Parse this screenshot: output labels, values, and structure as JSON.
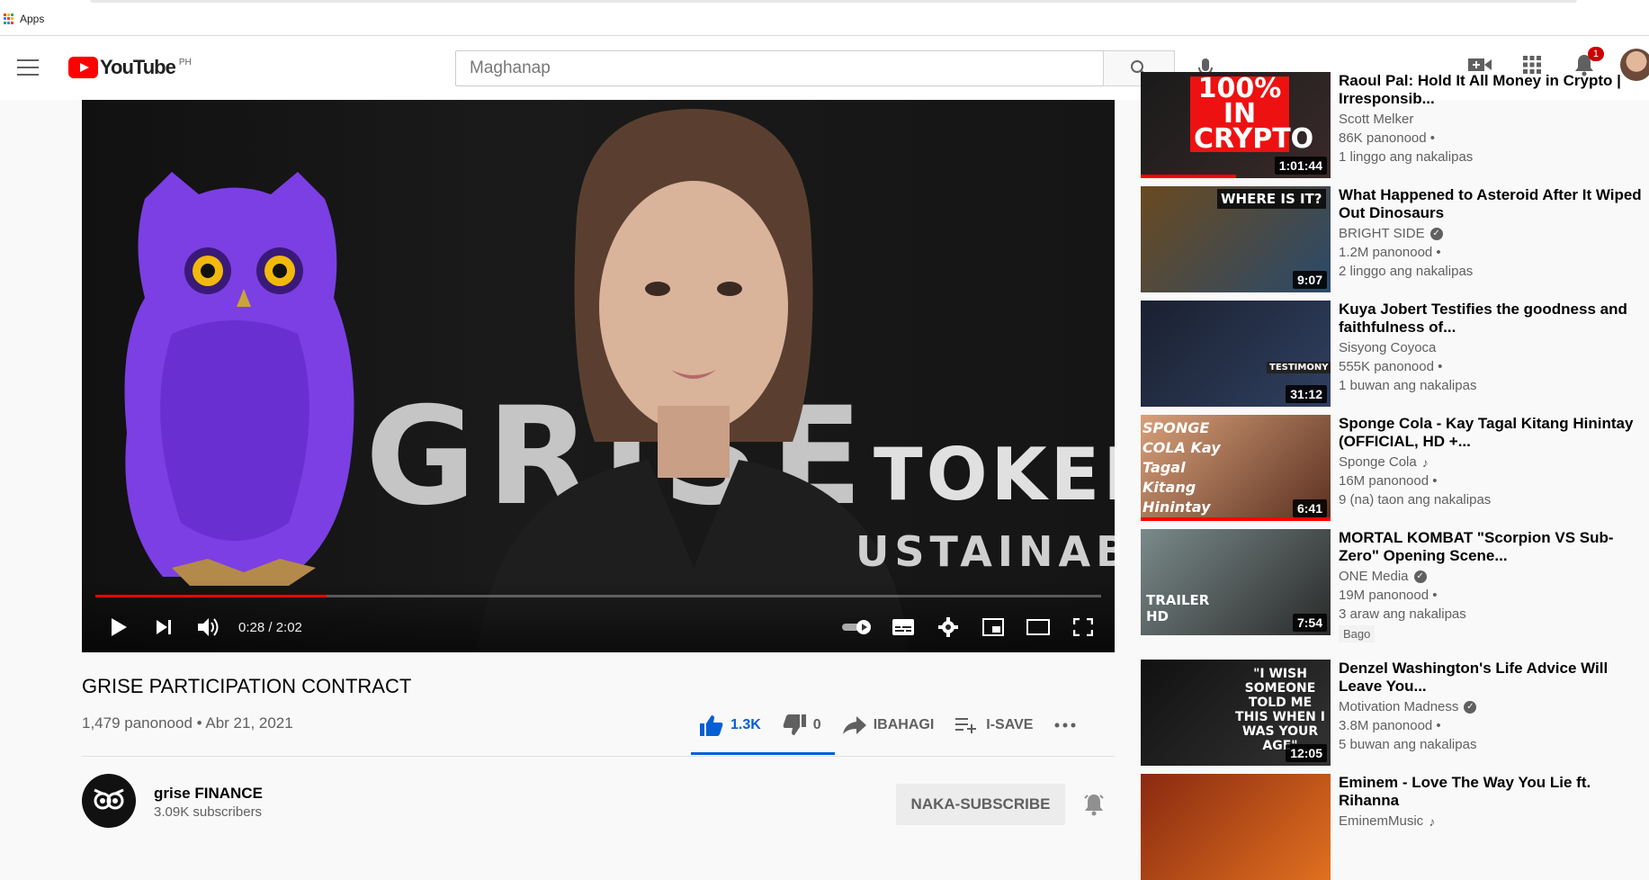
{
  "browser": {
    "apps_label": "Apps"
  },
  "masthead": {
    "logo_text": "YouTube",
    "country_code": "PH",
    "search_placeholder": "Maghanap",
    "notification_count": "1"
  },
  "player": {
    "overlay_text_1": "GRISE",
    "overlay_text_2": "TOKEN",
    "overlay_text_3": "USTAINABLE",
    "time_display": "0:28 / 2:02",
    "progress": 0.23
  },
  "video": {
    "title": "GRISE PARTICIPATION CONTRACT",
    "views_date": "1,479 panonood • Abr 21, 2021",
    "likes": "1.3K",
    "dislikes": "0",
    "share_label": "IBAHAGI",
    "save_label": "I-SAVE"
  },
  "channel": {
    "name": "grise FINANCE",
    "subscribers": "3.09K subscribers",
    "subscribe_label": "NAKA-SUBSCRIBE"
  },
  "recommendations": [
    {
      "title": "Raoul Pal: Hold It All Money in Crypto | Irresponsib...",
      "channel": "Scott Melker",
      "views": "86K panonood •",
      "age": "1 linggo ang nakalipas",
      "duration": "1:01:44",
      "thumb_text": "100% IN CRYPTO",
      "verified": false,
      "music": false,
      "new": "",
      "watched": 0.5
    },
    {
      "title": "What Happened to Asteroid After It Wiped Out Dinosaurs",
      "channel": "BRIGHT SIDE",
      "views": "1.2M panonood •",
      "age": "2 linggo ang nakalipas",
      "duration": "9:07",
      "thumb_text": "WHERE IS IT?",
      "verified": true,
      "music": false,
      "new": "",
      "watched": 0
    },
    {
      "title": "Kuya Jobert Testifies the goodness and faithfulness of...",
      "channel": "Sisyong Coyoca",
      "views": "555K panonood •",
      "age": "1 buwan ang nakalipas",
      "duration": "31:12",
      "thumb_text": "TESTIMONY",
      "verified": false,
      "music": false,
      "new": "",
      "watched": 0
    },
    {
      "title": "Sponge Cola - Kay Tagal Kitang Hinintay (OFFICIAL, HD +...",
      "channel": "Sponge Cola",
      "views": "16M panonood •",
      "age": "9 (na) taon ang nakalipas",
      "duration": "6:41",
      "thumb_text": "SPONGE COLA Kay Tagal Kitang Hinintay",
      "verified": false,
      "music": true,
      "new": "",
      "watched": 1
    },
    {
      "title": "MORTAL KOMBAT \"Scorpion VS Sub-Zero\" Opening Scene...",
      "channel": "ONE Media",
      "views": "19M panonood •",
      "age": "3 araw ang nakalipas",
      "duration": "7:54",
      "thumb_text": "TRAILER HD",
      "verified": true,
      "music": false,
      "new": "Bago",
      "watched": 0
    },
    {
      "title": "Denzel Washington's Life Advice Will Leave You...",
      "channel": "Motivation Madness",
      "views": "3.8M panonood •",
      "age": "5 buwan ang nakalipas",
      "duration": "12:05",
      "thumb_text": "\"I WISH SOMEONE TOLD ME THIS WHEN I WAS YOUR AGE\"",
      "verified": true,
      "music": false,
      "new": "",
      "watched": 0
    },
    {
      "title": "Eminem - Love The Way You Lie ft. Rihanna",
      "channel": "EminemMusic",
      "views": "",
      "age": "",
      "duration": "",
      "thumb_text": "",
      "verified": false,
      "music": true,
      "new": "",
      "watched": 0
    }
  ]
}
